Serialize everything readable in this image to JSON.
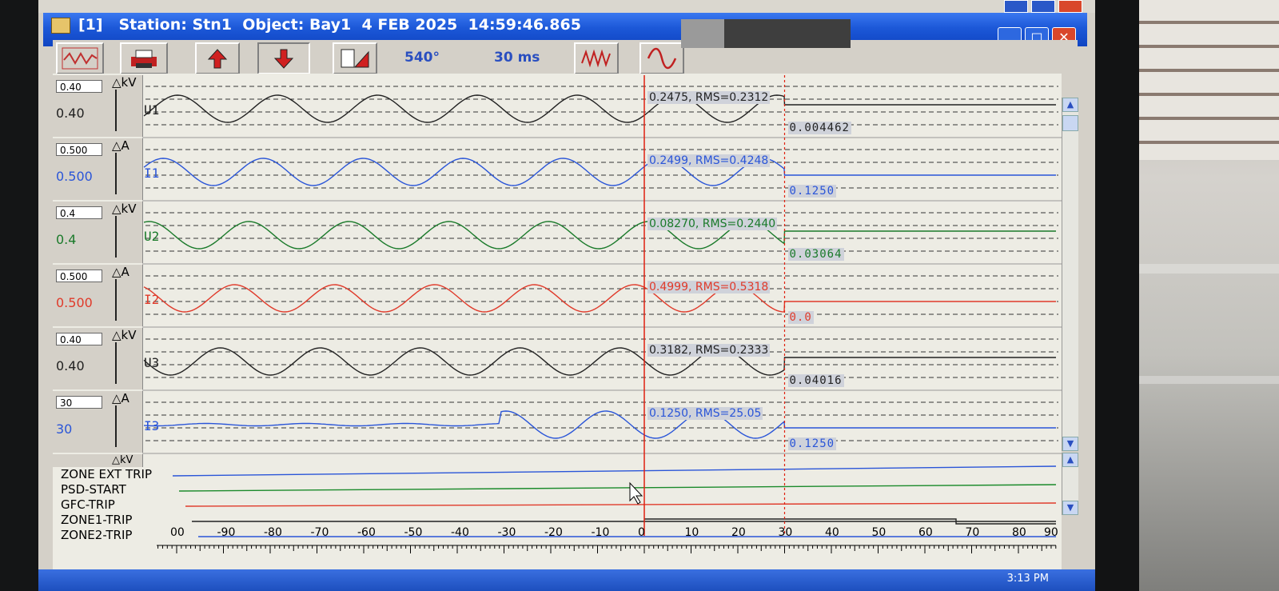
{
  "window": {
    "title_index": "[1]",
    "station_label": "Station:",
    "station": "Stn1",
    "object_label": "Object:",
    "object": "Bay1",
    "date": "4 FEB 2025",
    "time": "14:59:46.865"
  },
  "toolbar": {
    "angle": "540°",
    "time_window": "30 ms",
    "icons": [
      "waveform-overview-icon",
      "printer-icon",
      "arrow-up-icon",
      "arrow-down-icon",
      "calculator-icon",
      "multi-wave-icon",
      "sine-wave-icon"
    ]
  },
  "channels": [
    {
      "name": "U1",
      "scale_box": "0.40",
      "scale_value": "0.40",
      "unit": "kV",
      "color": "#222222",
      "measurement": "0.2475, RMS=0.2312",
      "after_value": "0.004462"
    },
    {
      "name": "I1",
      "scale_box": "0.500",
      "scale_value": "0.500",
      "unit": "A",
      "color": "#2a55d8",
      "measurement": "0.2499, RMS=0.4248",
      "after_value": "0.1250"
    },
    {
      "name": "U2",
      "scale_box": "0.4",
      "scale_value": "0.4",
      "unit": "kV",
      "color": "#1a7a2a",
      "measurement": "0.08270, RMS=0.2440",
      "after_value": "0.03064"
    },
    {
      "name": "I2",
      "scale_box": "0.500",
      "scale_value": "0.500",
      "unit": "A",
      "color": "#e03a2a",
      "measurement": "0.4999, RMS=0.5318",
      "after_value": "0.0"
    },
    {
      "name": "U3",
      "scale_box": "0.40",
      "scale_value": "0.40",
      "unit": "kV",
      "color": "#222222",
      "measurement": "0.3182, RMS=0.2333",
      "after_value": "0.04016"
    },
    {
      "name": "I3",
      "scale_box": "30",
      "scale_value": "30",
      "unit": "A",
      "color": "#2a55d8",
      "measurement": "0.1250, RMS=25.05",
      "after_value": "0.1250"
    }
  ],
  "partial_channel_unit": "kV",
  "digital_channels": [
    {
      "name": "ZONE EXT TRIP",
      "color": "#2a55d8"
    },
    {
      "name": "PSD-START",
      "color": "#1a8a2a"
    },
    {
      "name": "GFC-TRIP",
      "color": "#e03a2a"
    },
    {
      "name": "ZONE1-TRIP",
      "color": "#222222"
    },
    {
      "name": "ZONE2-TRIP",
      "color": "#2a55d8"
    }
  ],
  "time_axis": {
    "ticks": [
      "00",
      "-90",
      "-80",
      "-70",
      "-60",
      "-50",
      "-40",
      "-30",
      "-20",
      "-10",
      "0",
      "10",
      "20",
      "30",
      "40",
      "50",
      "60",
      "70",
      "80",
      "90"
    ],
    "trigger_ms": 0,
    "cursor_ms": 30
  },
  "taskbar": {
    "clock": "3:13 PM"
  },
  "colors": {
    "trigger_line": "#e02010",
    "title_bar": "#1c58d8",
    "grid_dash": "#333333"
  }
}
